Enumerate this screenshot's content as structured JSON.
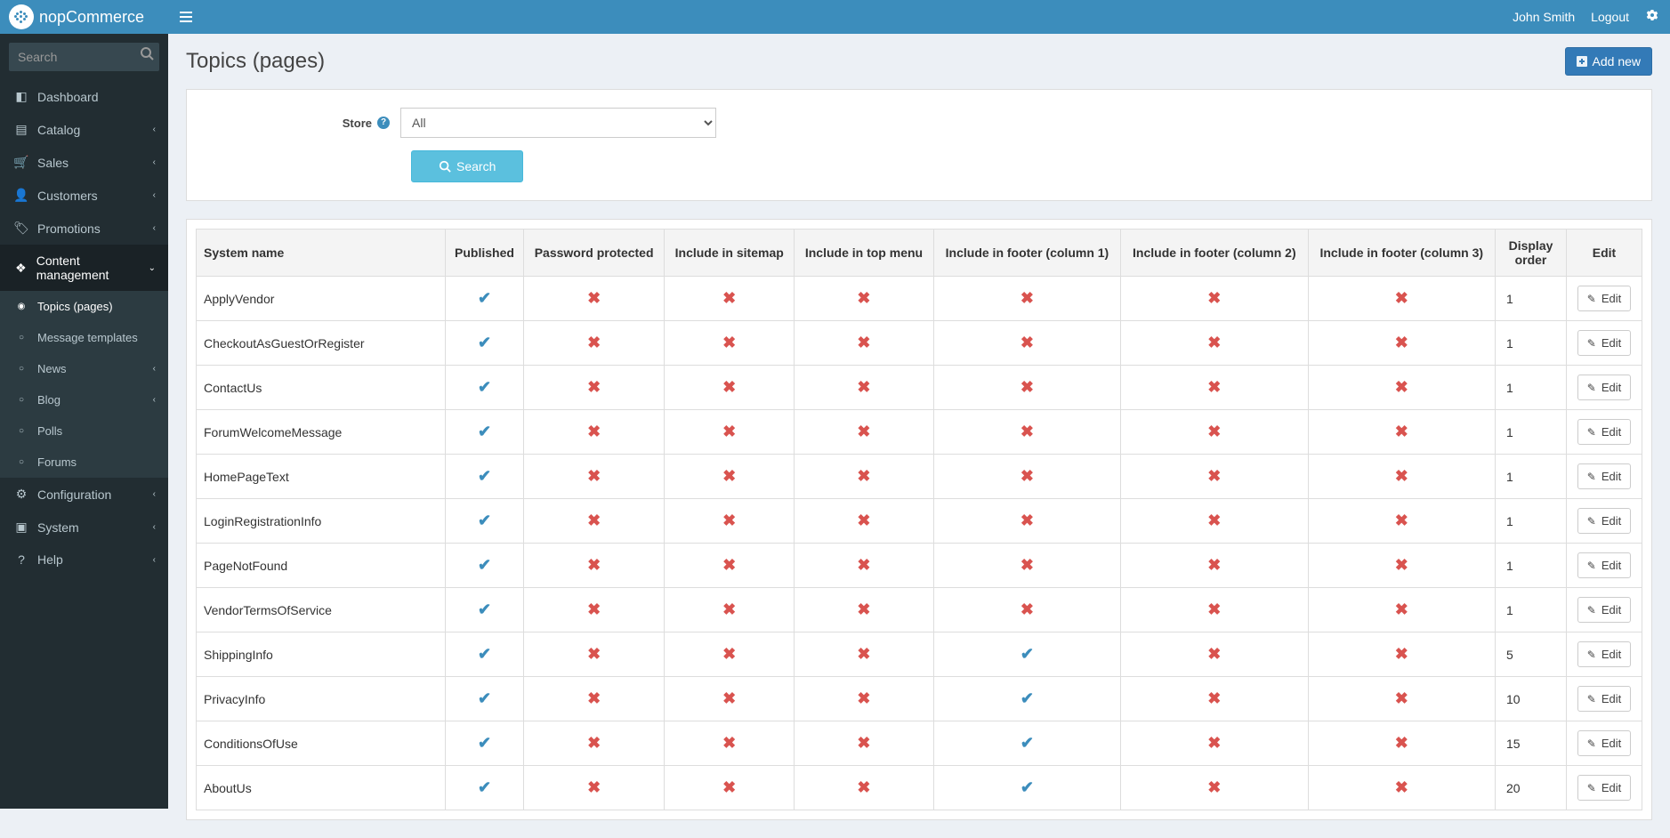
{
  "header": {
    "brand": "nopCommerce",
    "user": "John Smith",
    "logout": "Logout"
  },
  "sidebar": {
    "search_placeholder": "Search",
    "items": {
      "dashboard": "Dashboard",
      "catalog": "Catalog",
      "sales": "Sales",
      "customers": "Customers",
      "promotions": "Promotions",
      "content": "Content management",
      "configuration": "Configuration",
      "system": "System",
      "help": "Help"
    },
    "content_sub": {
      "topics": "Topics (pages)",
      "message_templates": "Message templates",
      "news": "News",
      "blog": "Blog",
      "polls": "Polls",
      "forums": "Forums"
    }
  },
  "page": {
    "title": "Topics (pages)",
    "add_new": "Add new"
  },
  "search_panel": {
    "store_label": "Store",
    "store_value": "All",
    "search_btn": "Search"
  },
  "table": {
    "headers": {
      "system_name": "System name",
      "published": "Published",
      "password": "Password protected",
      "sitemap": "Include in sitemap",
      "topmenu": "Include in top menu",
      "footer1": "Include in footer (column 1)",
      "footer2": "Include in footer (column 2)",
      "footer3": "Include in footer (column 3)",
      "display_order": "Display order",
      "edit": "Edit"
    },
    "edit_label": "Edit",
    "rows": [
      {
        "name": "ApplyVendor",
        "published": true,
        "password": false,
        "sitemap": false,
        "topmenu": false,
        "f1": false,
        "f2": false,
        "f3": false,
        "order": 1
      },
      {
        "name": "CheckoutAsGuestOrRegister",
        "published": true,
        "password": false,
        "sitemap": false,
        "topmenu": false,
        "f1": false,
        "f2": false,
        "f3": false,
        "order": 1
      },
      {
        "name": "ContactUs",
        "published": true,
        "password": false,
        "sitemap": false,
        "topmenu": false,
        "f1": false,
        "f2": false,
        "f3": false,
        "order": 1
      },
      {
        "name": "ForumWelcomeMessage",
        "published": true,
        "password": false,
        "sitemap": false,
        "topmenu": false,
        "f1": false,
        "f2": false,
        "f3": false,
        "order": 1
      },
      {
        "name": "HomePageText",
        "published": true,
        "password": false,
        "sitemap": false,
        "topmenu": false,
        "f1": false,
        "f2": false,
        "f3": false,
        "order": 1
      },
      {
        "name": "LoginRegistrationInfo",
        "published": true,
        "password": false,
        "sitemap": false,
        "topmenu": false,
        "f1": false,
        "f2": false,
        "f3": false,
        "order": 1
      },
      {
        "name": "PageNotFound",
        "published": true,
        "password": false,
        "sitemap": false,
        "topmenu": false,
        "f1": false,
        "f2": false,
        "f3": false,
        "order": 1
      },
      {
        "name": "VendorTermsOfService",
        "published": true,
        "password": false,
        "sitemap": false,
        "topmenu": false,
        "f1": false,
        "f2": false,
        "f3": false,
        "order": 1
      },
      {
        "name": "ShippingInfo",
        "published": true,
        "password": false,
        "sitemap": false,
        "topmenu": false,
        "f1": true,
        "f2": false,
        "f3": false,
        "order": 5
      },
      {
        "name": "PrivacyInfo",
        "published": true,
        "password": false,
        "sitemap": false,
        "topmenu": false,
        "f1": true,
        "f2": false,
        "f3": false,
        "order": 10
      },
      {
        "name": "ConditionsOfUse",
        "published": true,
        "password": false,
        "sitemap": false,
        "topmenu": false,
        "f1": true,
        "f2": false,
        "f3": false,
        "order": 15
      },
      {
        "name": "AboutUs",
        "published": true,
        "password": false,
        "sitemap": false,
        "topmenu": false,
        "f1": true,
        "f2": false,
        "f3": false,
        "order": 20
      }
    ]
  }
}
